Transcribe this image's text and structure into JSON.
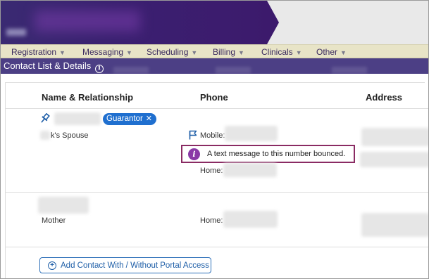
{
  "menu": {
    "items": [
      {
        "label": "Registration"
      },
      {
        "label": "Messaging"
      },
      {
        "label": "Scheduling"
      },
      {
        "label": "Billing"
      },
      {
        "label": "Clinicals"
      },
      {
        "label": "Other"
      }
    ],
    "caret": "▼"
  },
  "page": {
    "title": "Contact List & Details",
    "info_glyph": "i"
  },
  "table": {
    "headers": {
      "name": "Name & Relationship",
      "phone": "Phone",
      "address": "Address"
    },
    "rows": [
      {
        "badge": "Guarantor",
        "badge_close": "✕",
        "relationship": "k's Spouse",
        "phone_mobile_label": "Mobile:",
        "alert_text": "A text message to this number bounced.",
        "alert_glyph": "i",
        "phone_home_label": "Home:"
      },
      {
        "relationship": "Mother",
        "phone_home_label": "Home:"
      }
    ]
  },
  "actions": {
    "add_contact_label": "Add Contact With / Without Portal Access",
    "add_glyph": "+"
  },
  "colors": {
    "brand_purple": "#4c3f85",
    "banner_purple": "#3d1e73",
    "menu_bg": "#e8e4c7",
    "badge_blue": "#1f6fcf",
    "alert_border": "#8a2b63",
    "alert_icon": "#8a39a6"
  }
}
